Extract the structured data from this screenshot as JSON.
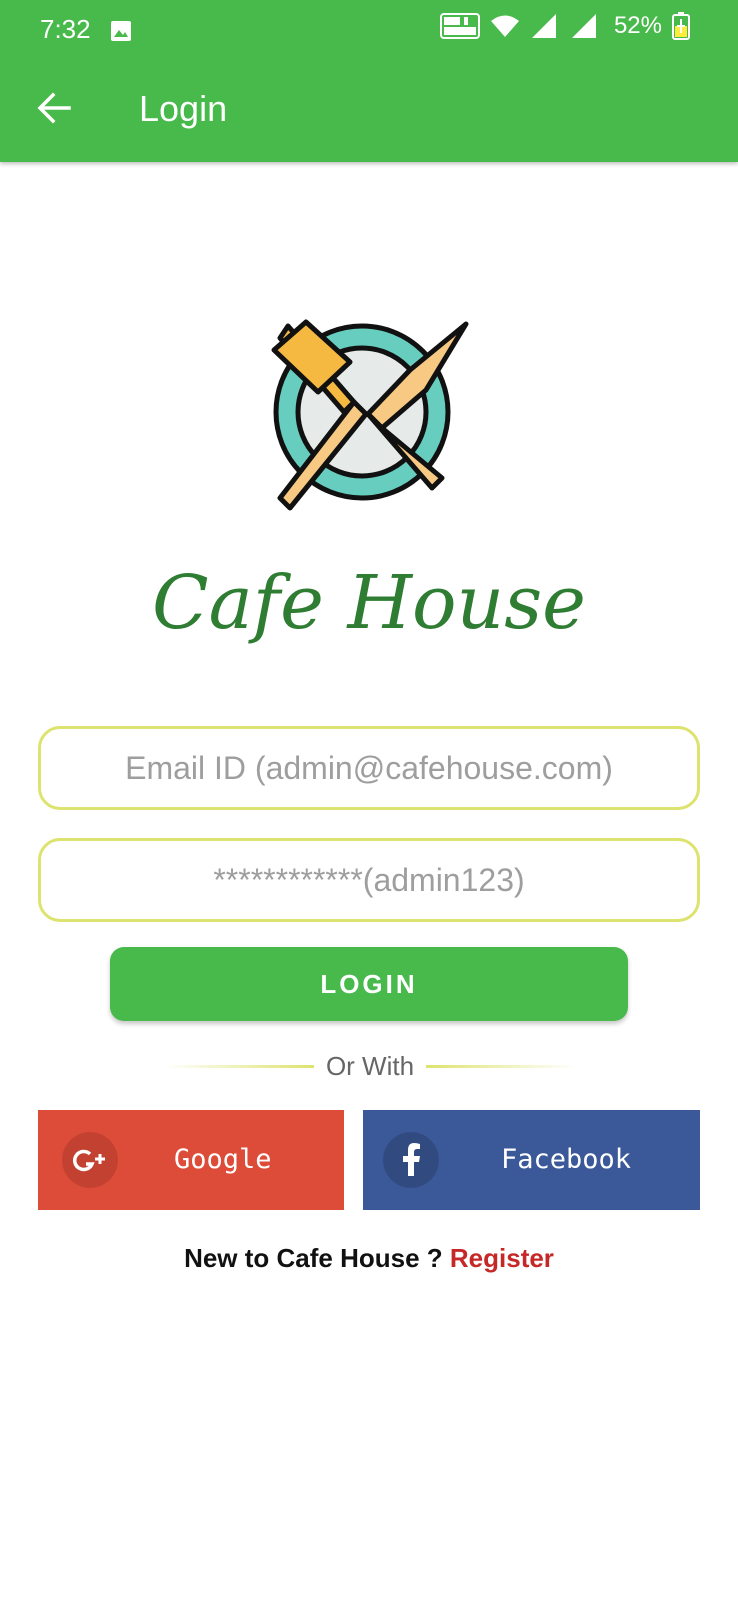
{
  "status_bar": {
    "time": "7:32",
    "battery_percent": "52%",
    "icons": [
      "image-icon",
      "vowifi-icon",
      "wifi-icon",
      "signal-icon",
      "signal-icon",
      "battery-charging-icon"
    ]
  },
  "app_bar": {
    "title": "Login",
    "back_icon": "arrow-left-icon",
    "background": "#48b94b"
  },
  "brand": {
    "logo_icon": "plate-fork-knife-icon",
    "name": "Cafe House",
    "color": "#2e7d32"
  },
  "form": {
    "email_placeholder": "Email ID (admin@cafehouse.com)",
    "password_placeholder": "************(admin123)",
    "login_label": "LOGIN",
    "divider_text": "Or With",
    "border_color": "#dde36f"
  },
  "social": {
    "google_label": "Google",
    "google_icon": "google-plus-icon",
    "google_color": "#dd4b39",
    "facebook_label": "Facebook",
    "facebook_icon": "facebook-icon",
    "facebook_color": "#3b5998"
  },
  "register": {
    "prompt": "New to Cafe House ?",
    "link": "Register",
    "link_color": "#c62828"
  }
}
